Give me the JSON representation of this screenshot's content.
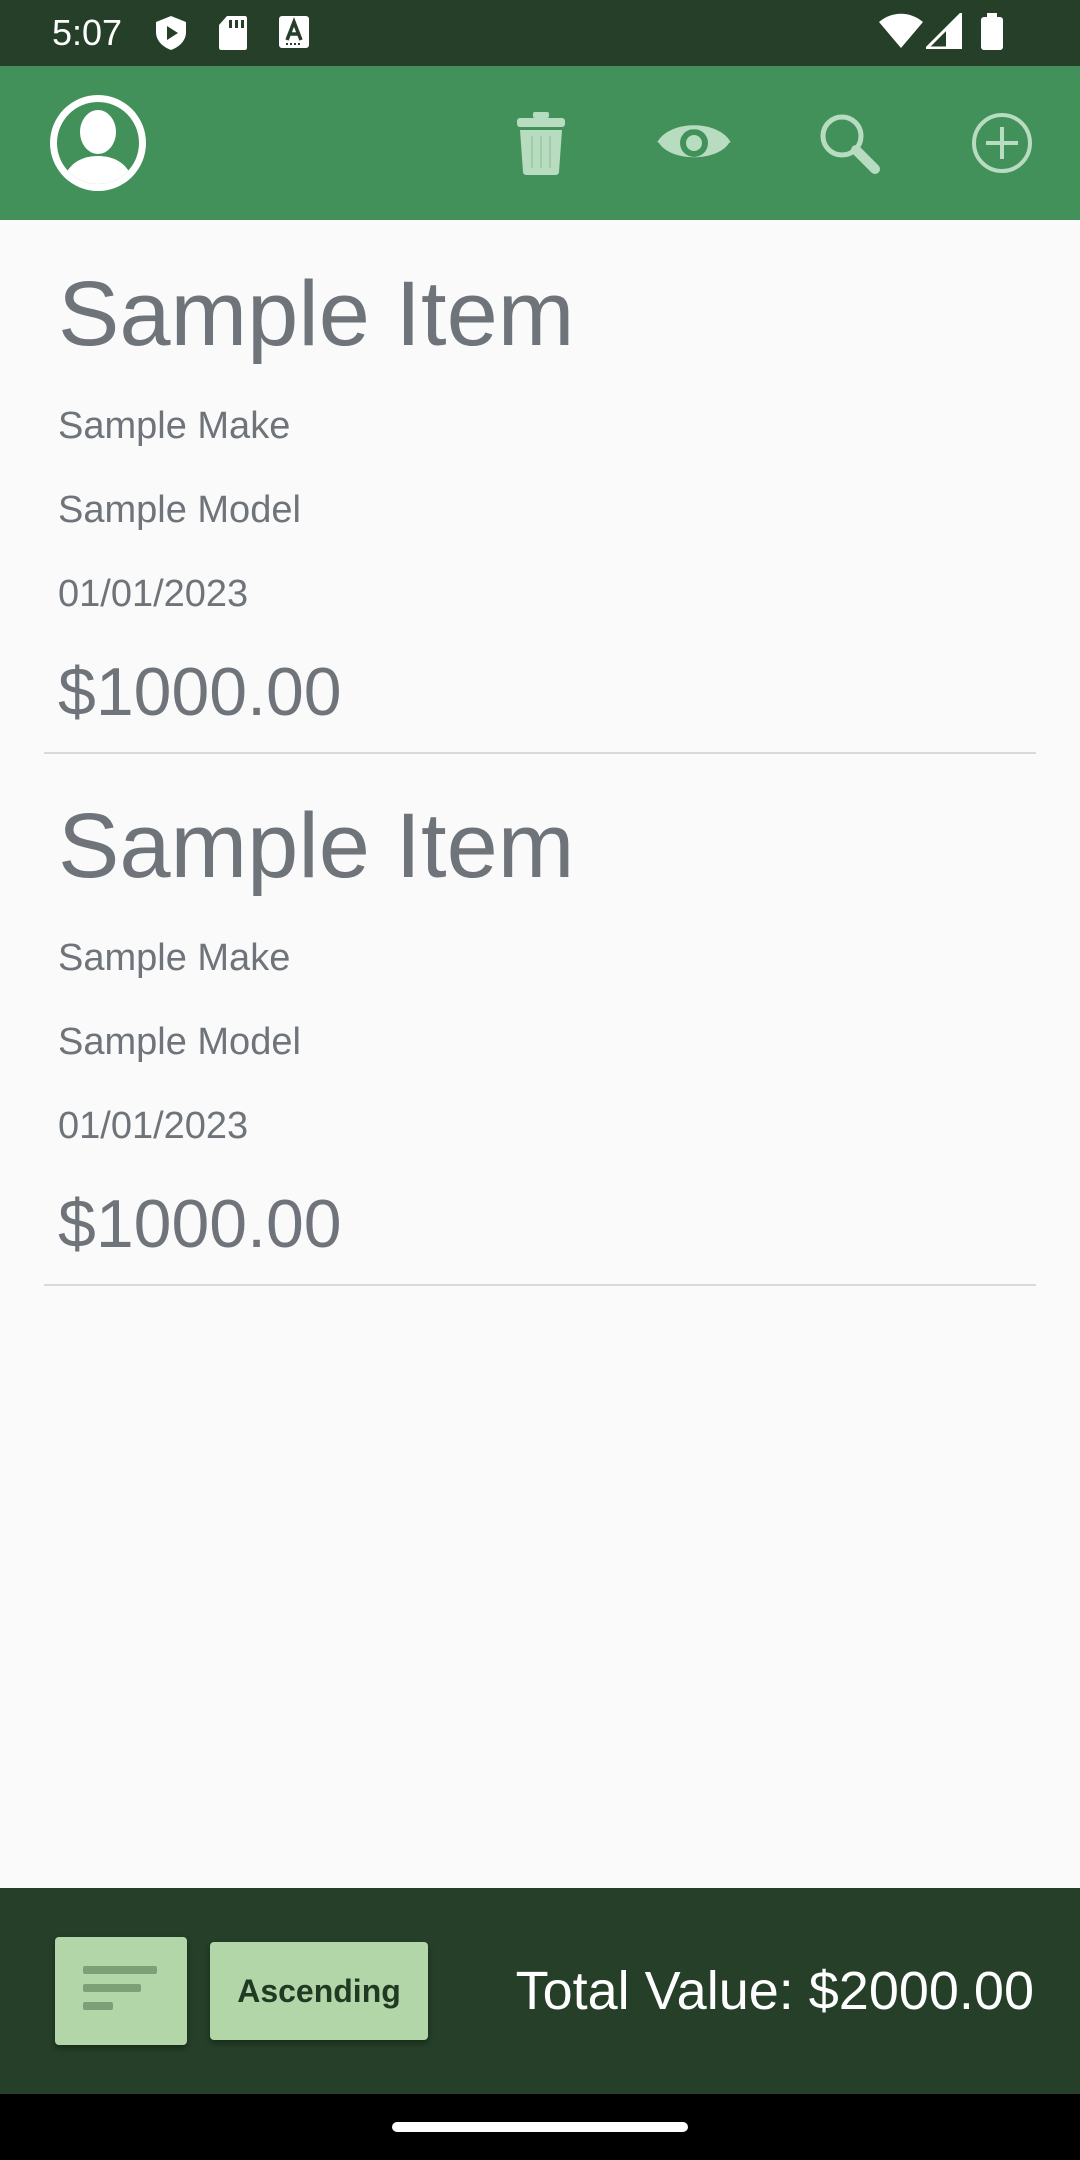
{
  "status_bar": {
    "time": "5:07",
    "left_icons": [
      "play-protect-icon",
      "sd-card-icon",
      "keyboard-a-icon"
    ],
    "right_icons": [
      "wifi-icon",
      "cell-signal-icon",
      "battery-icon"
    ]
  },
  "app_bar": {
    "avatar_icon": "person-avatar-icon",
    "actions": [
      "trash-icon",
      "eye-icon",
      "search-icon",
      "add-circle-icon"
    ]
  },
  "items": [
    {
      "name": "Sample Item",
      "make": "Sample Make",
      "model": "Sample Model",
      "date": "01/01/2023",
      "price": "$1000.00"
    },
    {
      "name": "Sample Item",
      "make": "Sample Make",
      "model": "Sample Model",
      "date": "01/01/2023",
      "price": "$1000.00"
    }
  ],
  "bottom_bar": {
    "sort_icon": "sort-lines-icon",
    "order_label": "Ascending",
    "total_value": "Total Value: $2000.00"
  },
  "colors": {
    "status_bar": "#253f28",
    "app_bar": "#42915a",
    "bottom_bar": "#253f28",
    "button_fill": "#b3d6a9",
    "item_text": "#6f747a",
    "background": "#fafafa"
  }
}
